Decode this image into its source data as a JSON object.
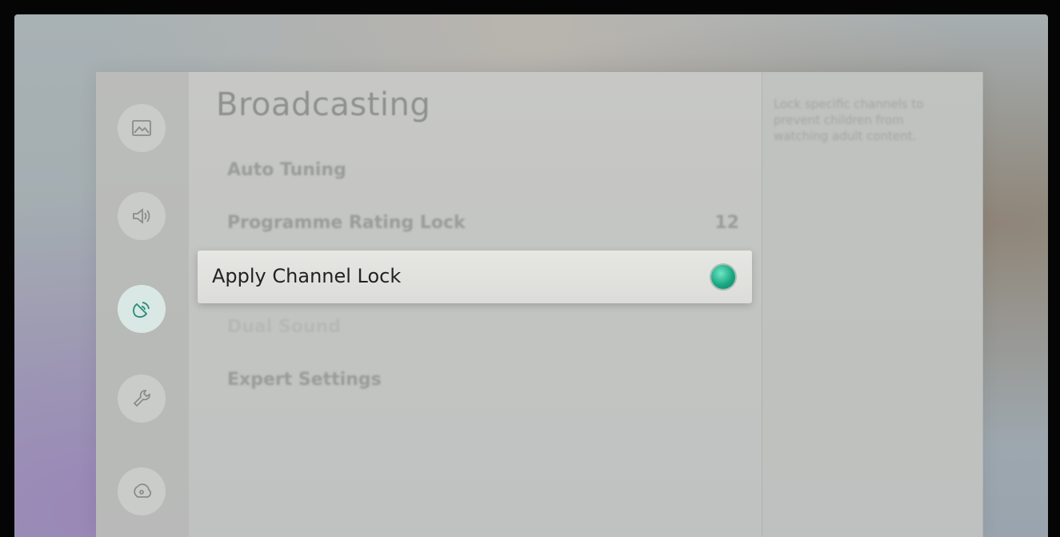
{
  "page": {
    "title": "Broadcasting"
  },
  "sidebar": {
    "icons": [
      {
        "name": "picture-icon"
      },
      {
        "name": "sound-icon"
      },
      {
        "name": "broadcasting-icon",
        "active": true
      },
      {
        "name": "general-wrench-icon"
      },
      {
        "name": "support-icon"
      }
    ]
  },
  "menu": {
    "items": [
      {
        "label": "Auto Tuning",
        "value": ""
      },
      {
        "label": "Programme Rating Lock",
        "value": "12"
      },
      {
        "label": "Apply Channel Lock",
        "selected": true,
        "toggle_on": true
      },
      {
        "label": "Dual Sound",
        "value": "",
        "disabled": true
      },
      {
        "label": "Expert Settings",
        "value": ""
      }
    ]
  },
  "description": {
    "text": "Lock specific channels to prevent children from watching adult content."
  },
  "colors": {
    "toggle_on": "#1aa882",
    "selected_bg": "#e3e3e0",
    "panel_bg": "#c4c6c4"
  }
}
